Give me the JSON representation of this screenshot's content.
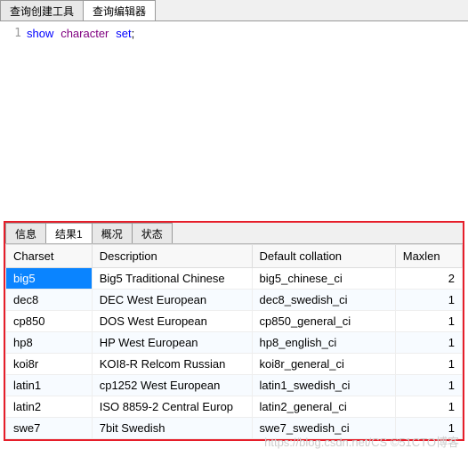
{
  "top_tabs": {
    "create": "查询创建工具",
    "editor": "查询编辑器"
  },
  "code": {
    "line_no": "1",
    "kw1": "show",
    "kw2": "character",
    "kw3": "set",
    "semi": ";"
  },
  "result_tabs": {
    "info": "信息",
    "result1": "结果1",
    "profile": "概况",
    "status": "状态"
  },
  "columns": {
    "charset": "Charset",
    "description": "Description",
    "collation": "Default collation",
    "maxlen": "Maxlen"
  },
  "rows": [
    {
      "charset": "big5",
      "description": "Big5 Traditional Chinese",
      "collation": "big5_chinese_ci",
      "maxlen": "2"
    },
    {
      "charset": "dec8",
      "description": "DEC West European",
      "collation": "dec8_swedish_ci",
      "maxlen": "1"
    },
    {
      "charset": "cp850",
      "description": "DOS West European",
      "collation": "cp850_general_ci",
      "maxlen": "1"
    },
    {
      "charset": "hp8",
      "description": "HP West European",
      "collation": "hp8_english_ci",
      "maxlen": "1"
    },
    {
      "charset": "koi8r",
      "description": "KOI8-R Relcom Russian",
      "collation": "koi8r_general_ci",
      "maxlen": "1"
    },
    {
      "charset": "latin1",
      "description": "cp1252 West European",
      "collation": "latin1_swedish_ci",
      "maxlen": "1"
    },
    {
      "charset": "latin2",
      "description": "ISO 8859-2 Central Europ",
      "collation": "latin2_general_ci",
      "maxlen": "1"
    },
    {
      "charset": "swe7",
      "description": "7bit Swedish",
      "collation": "swe7_swedish_ci",
      "maxlen": "1"
    }
  ],
  "watermark": "https://blog.csdn.net/CS  ©51CTO博客"
}
